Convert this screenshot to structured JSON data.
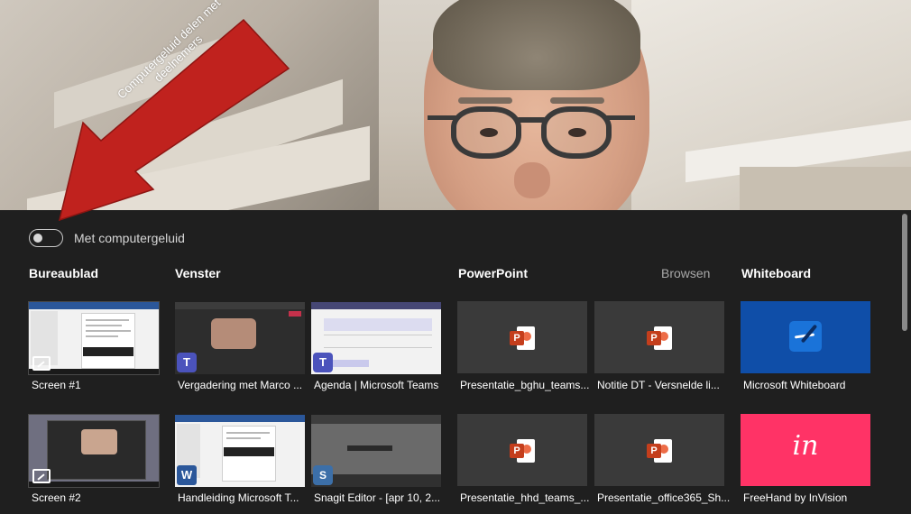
{
  "annotation": {
    "text_line1": "Computergeluid delen met",
    "text_line2": "deelnemers",
    "color": "#c0221e"
  },
  "toggle": {
    "label": "Met computergeluid",
    "state": "off"
  },
  "sections": {
    "desktop": "Bureaublad",
    "window": "Venster",
    "powerpoint": "PowerPoint",
    "browse": "Browsen",
    "whiteboard": "Whiteboard"
  },
  "desktop_items": [
    {
      "label": "Screen #1",
      "icon": "share-screen-icon"
    },
    {
      "label": "Screen #2",
      "icon": "share-screen-icon"
    }
  ],
  "window_items": [
    {
      "label": "Vergadering met Marco ...",
      "app": "teams",
      "glyph": "T"
    },
    {
      "label": "Agenda | Microsoft Teams",
      "app": "teams",
      "glyph": "T"
    },
    {
      "label": "Handleiding Microsoft T...",
      "app": "word",
      "glyph": "W"
    },
    {
      "label": "Snagit Editor - [apr 10, 2...",
      "app": "snagit",
      "glyph": "S"
    }
  ],
  "powerpoint_items": [
    {
      "label": "Presentatie_bghu_teams..."
    },
    {
      "label": "Notitie DT - Versnelde li..."
    },
    {
      "label": "Presentatie_hhd_teams_..."
    },
    {
      "label": "Presentatie_office365_Sh..."
    }
  ],
  "powerpoint_badge": "P",
  "whiteboard_items": [
    {
      "label": "Microsoft Whiteboard",
      "color": "#0f4ea8"
    },
    {
      "label": "FreeHand by InVision",
      "color": "#ff3366",
      "logo_text": "in"
    }
  ]
}
